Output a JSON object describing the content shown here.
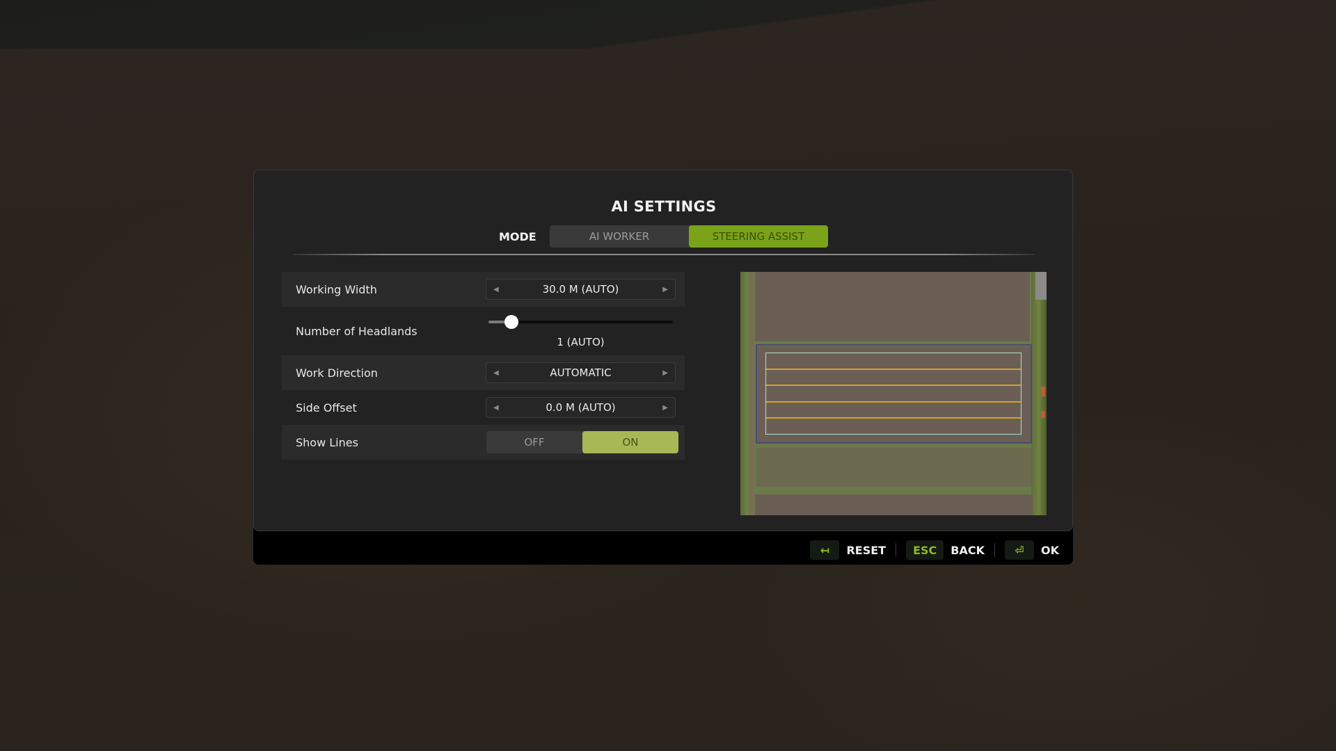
{
  "dialog": {
    "title": "AI SETTINGS",
    "mode": {
      "label": "MODE",
      "tabs": [
        {
          "label": "AI WORKER",
          "active": false
        },
        {
          "label": "STEERING ASSIST",
          "active": true
        }
      ]
    },
    "settings": [
      {
        "label": "Working Width",
        "type": "selector",
        "value": "30.0 M (AUTO)"
      },
      {
        "label": "Number of Headlands",
        "type": "slider",
        "value": "1 (AUTO)",
        "slider_fraction": 0.1
      },
      {
        "label": "Work Direction",
        "type": "selector",
        "value": "AUTOMATIC"
      },
      {
        "label": "Side Offset",
        "type": "selector",
        "value": "0.0 M (AUTO)"
      },
      {
        "label": "Show Lines",
        "type": "toggle",
        "options": [
          "OFF",
          "ON"
        ],
        "selected": "ON"
      }
    ],
    "preview": {
      "name": "field-preview-map",
      "work_lines": 4
    }
  },
  "footer": {
    "buttons": [
      {
        "key": "↤",
        "key_icon": "reset-arrow-icon",
        "label": "RESET"
      },
      {
        "key": "ESC",
        "label": "BACK"
      },
      {
        "key": "⏎",
        "key_icon": "enter-icon",
        "label": "OK"
      }
    ]
  },
  "colors": {
    "accent_green": "#7aa319",
    "toggle_on": "#a8b854",
    "key_text": "#8dba1f",
    "work_line": "#d6a12a",
    "work_area_outline": "#a8e0c8"
  }
}
